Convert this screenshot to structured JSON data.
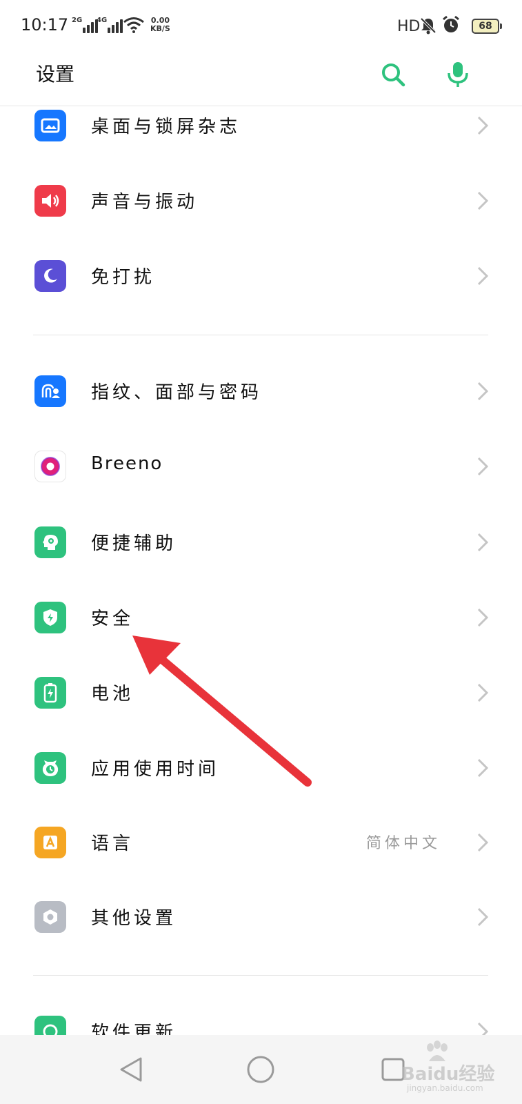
{
  "status_bar": {
    "time": "10:17",
    "signal_1_tag": "2G",
    "signal_2_tag": "4G",
    "net_speed_value": "0.00",
    "net_speed_unit": "KB/S",
    "hd_label": "HD",
    "battery_level": "68"
  },
  "header": {
    "title": "设置",
    "accent_color": "#2ec27e"
  },
  "settings_items": [
    {
      "label": "桌面与锁屏杂志",
      "icon": "wallpaper-icon",
      "color": "#1677ff"
    },
    {
      "label": "声音与振动",
      "icon": "speaker-icon",
      "color": "#ef3b4a"
    },
    {
      "label": "免打扰",
      "icon": "moon-icon",
      "color": "#5b4fd6"
    },
    {
      "label": "指纹、面部与密码",
      "icon": "fingerprint-face-icon",
      "color": "#1677ff"
    },
    {
      "label": "Breeno",
      "icon": "breeno-icon",
      "color": "#e0207a"
    },
    {
      "label": "便捷辅助",
      "icon": "assist-head-icon",
      "color": "#2ec27e"
    },
    {
      "label": "安全",
      "icon": "shield-icon",
      "color": "#2ec27e"
    },
    {
      "label": "电池",
      "icon": "battery-icon",
      "color": "#2ec27e"
    },
    {
      "label": "应用使用时间",
      "icon": "app-time-icon",
      "color": "#2ec27e"
    },
    {
      "label": "语言",
      "icon": "language-icon",
      "color": "#f5a623",
      "value": "简体中文"
    },
    {
      "label": "其他设置",
      "icon": "other-settings-icon",
      "color": "#b8bcc4"
    },
    {
      "label": "软件更新",
      "icon": "update-icon",
      "color": "#2ec27e"
    }
  ],
  "watermark": {
    "text": "Baidu经验",
    "sub": "jingyan.baidu.com"
  },
  "annotation": {
    "arrow_color": "#e8333a"
  }
}
